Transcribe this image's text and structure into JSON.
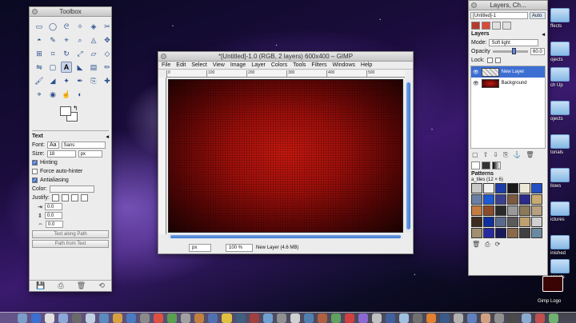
{
  "toolbox": {
    "title": "Toolbox",
    "tool_icons": [
      "rect-select-icon",
      "ellipse-select-icon",
      "lasso-icon",
      "fuzzy-select-icon",
      "color-select-icon",
      "scissors-icon",
      "foreground-select-icon",
      "paths-icon",
      "color-picker-icon",
      "zoom-icon",
      "measure-icon",
      "move-icon",
      "align-icon",
      "crop-icon",
      "rotate-icon",
      "scale-icon",
      "shear-icon",
      "perspective-icon",
      "flip-icon",
      "cage-icon",
      "text-icon",
      "bucket-fill-icon",
      "blend-icon",
      "pencil-icon",
      "paintbrush-icon",
      "eraser-icon",
      "airbrush-icon",
      "ink-icon",
      "clone-icon",
      "heal-icon",
      "perspective-clone-icon",
      "blur-icon",
      "smudge-icon",
      "dodge-icon"
    ],
    "tool_glyphs": [
      "▭",
      "◯",
      "ᘓ",
      "✧",
      "◈",
      "✂",
      "◓",
      "✎",
      "⌖",
      "⌕",
      "◬",
      "✥",
      "⊞",
      "⌗",
      "↻",
      "⤢",
      "▱",
      "◇",
      "⇋",
      "▢",
      "A",
      "◣",
      "▤",
      "✏",
      "🖌",
      "◢",
      "✦",
      "✒",
      "⎘",
      "✚",
      "⌖",
      "◉",
      "☝",
      "◐"
    ],
    "options": {
      "header": "Text",
      "font_label": "Font:",
      "font_preview": "Aa",
      "font_value": "Sans",
      "size_label": "Size:",
      "size_value": "18",
      "size_unit": "px",
      "hinting": "Hinting",
      "force_autohinter": "Force auto-hinter",
      "antialiasing": "Antialiasing",
      "color_label": "Color:",
      "justify_label": "Justify:",
      "indent_value": "0.0",
      "line_spacing_value": "0.0",
      "letter_spacing_value": "0.0",
      "text_along_path": "Text along Path",
      "path_from_text": "Path from Text"
    }
  },
  "image_window": {
    "title": "*[Untitled]-1.0 (RGB, 2 layers) 600x400 – GIMP",
    "menu": [
      "File",
      "Edit",
      "Select",
      "View",
      "Image",
      "Layer",
      "Colors",
      "Tools",
      "Filters",
      "Windows",
      "Help"
    ],
    "ruler_ticks": [
      "0",
      "100",
      "200",
      "300",
      "400",
      "500"
    ],
    "unit": "px",
    "zoom": "100 %",
    "status": "New Layer (4.6 MB)"
  },
  "layers_panel": {
    "title": "Layers, Ch...",
    "image_selector": "[Untitled]-1",
    "auto_button": "Auto",
    "section": "Layers",
    "mode_label": "Mode:",
    "mode_value": "Soft light",
    "opacity_label": "Opacity",
    "opacity_value": "60.0",
    "lock_label": "Lock:",
    "layers": [
      {
        "name": "New Layer",
        "selected": true
      },
      {
        "name": "Background",
        "selected": false
      }
    ],
    "patterns_header": "Patterns",
    "pattern_name": "a_tiles (12 × 6)",
    "pattern_colors": [
      "#c8c8c8",
      "#f0f0f0",
      "#1f3da8",
      "#1a1a1a",
      "#ece8d8",
      "#244fc4",
      "#6b7fa6",
      "#1b59d6",
      "#3c3f8e",
      "#7b5a3f",
      "#2a2a8a",
      "#c8ab72",
      "#c47c40",
      "#8a4c2a",
      "#2b2b2b",
      "#9a9a9a",
      "#8a7a5a",
      "#b8a080",
      "#3e2d1e",
      "#1030a0",
      "#5a6a8a",
      "#5a5a5a",
      "#c0a070",
      "#d0d0d0",
      "#a09070",
      "#2a2aa0",
      "#1a1a5a",
      "#8a6a4a",
      "#404040",
      "#6a8aa0"
    ]
  },
  "desktop": {
    "items": [
      "ffects",
      "ojects",
      "ch Up",
      "ojects",
      "torials",
      "llows",
      "ictures",
      "inished",
      "rojects",
      "Gimp Logo"
    ]
  }
}
